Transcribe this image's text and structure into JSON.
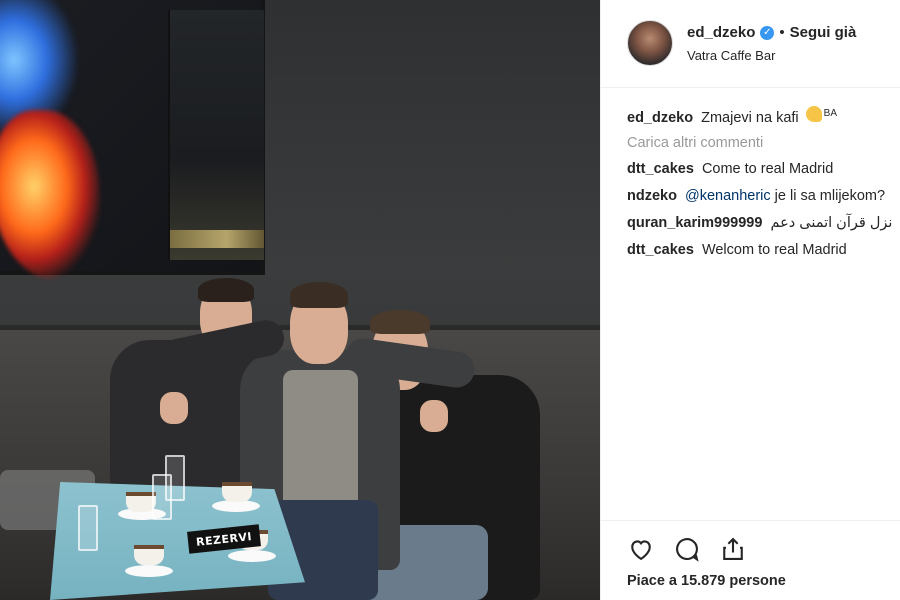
{
  "post": {
    "username": "ed_dzeko",
    "follow_status": "Segui già",
    "separator": "•",
    "location": "Vatra Caffe Bar"
  },
  "photo": {
    "table_sign": "REZERVI"
  },
  "caption": {
    "user": "ed_dzeko",
    "text": "Zmajevi na kafi",
    "badge": "BA"
  },
  "load_more": "Carica altri commenti",
  "comments": [
    {
      "user": "dtt_cakes",
      "text": "Come to real Madrid"
    },
    {
      "user": "ndzeko",
      "mention": "@kenanheric",
      "text": "je li sa mlijekom?"
    },
    {
      "user": "quran_karim999999",
      "text": "نزل قرآن اتمنى دعم"
    },
    {
      "user": "dtt_cakes",
      "text": "Welcom to real Madrid"
    }
  ],
  "actions": {
    "like_icon": "heart-icon",
    "comment_icon": "comment-icon",
    "share_icon": "share-icon",
    "likes_text": "Piace a 15.879 persone"
  },
  "colors": {
    "verified": "#3897f0",
    "muted": "#999999",
    "mention": "#003569"
  }
}
